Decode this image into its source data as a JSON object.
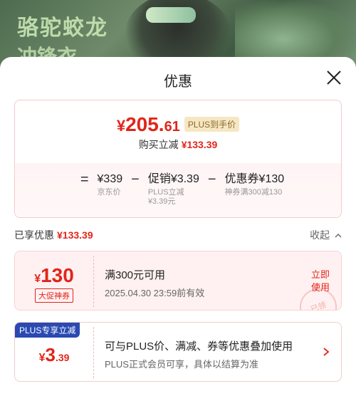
{
  "banner": {
    "line1": "骆驼蛟龙",
    "line2": "冲锋衣"
  },
  "sheet": {
    "title": "优惠"
  },
  "summary": {
    "currency": "¥",
    "price_int": "205.",
    "price_dec": "61",
    "plus_tag": "PLUS到手价",
    "save_label": "购买立减",
    "save_amount": "¥133.39",
    "formula": {
      "eq": "=",
      "term1": {
        "main": "¥339",
        "sub": "京东价"
      },
      "minus1": "−",
      "term2": {
        "main": "促销¥3.39",
        "sub1": "PLUS立减",
        "sub2": "¥3.39元"
      },
      "minus2": "−",
      "term3": {
        "main": "优惠券¥130",
        "sub": "神券满300减130"
      }
    }
  },
  "enjoyed": {
    "label": "已享优惠",
    "amount": "¥133.39",
    "collapse": "收起"
  },
  "coupon": {
    "currency": "¥",
    "value": "130",
    "tag": "大促神券",
    "title": "满300元可用",
    "expiry": "2025.04.30 23:59前有效",
    "use_line1": "立即",
    "use_line2": "使用",
    "stamp": "已领"
  },
  "plus": {
    "badge": "PLUS专享立减",
    "currency": "¥",
    "int": "3",
    "dec": ".39",
    "title": "可与PLUS价、满减、券等优惠叠加使用",
    "desc": "PLUS正式会员可享，具体以结算为准"
  },
  "colors": {
    "accent_red": "#e1251b",
    "plus_blue": "#2a49b2",
    "plus_gold_bg": "#f6e7c2"
  }
}
